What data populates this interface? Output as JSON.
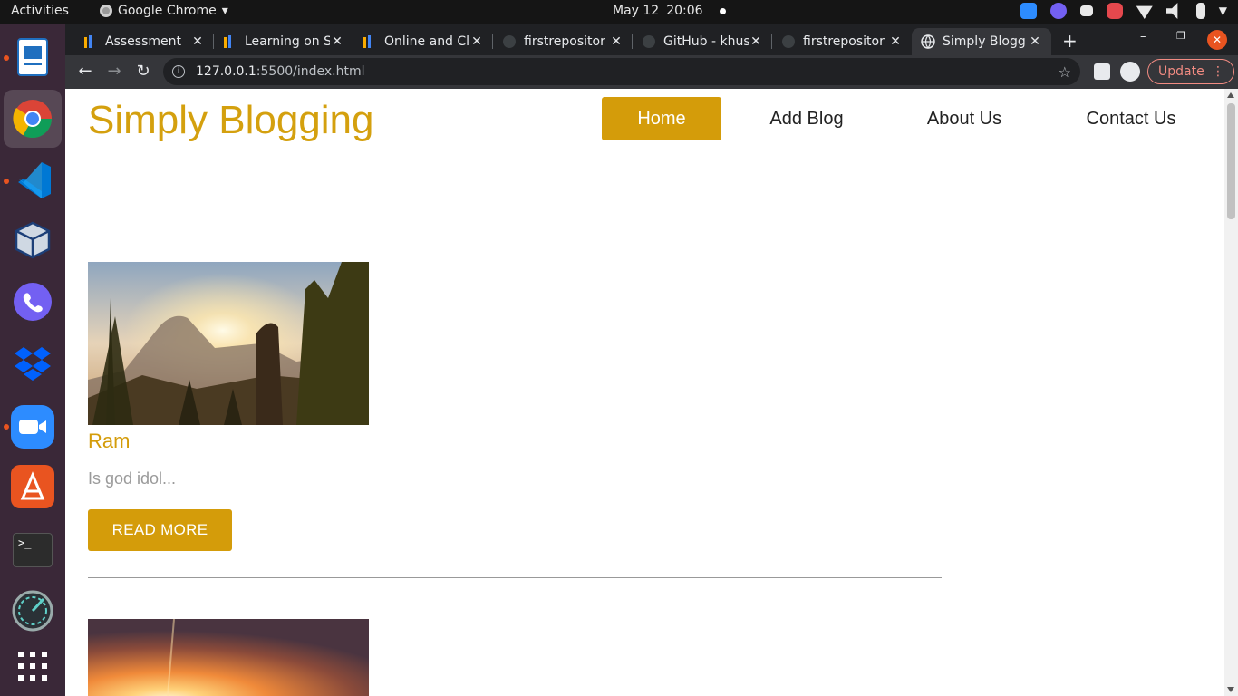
{
  "system": {
    "activities": "Activities",
    "app_name": "Google Chrome",
    "date": "May 12",
    "time": "20:06"
  },
  "browser": {
    "tabs": [
      {
        "label": "Assessment",
        "icon": "app-icon",
        "active": false
      },
      {
        "label": "Learning on S",
        "icon": "app-icon",
        "active": false
      },
      {
        "label": "Online and Cl",
        "icon": "app-icon",
        "active": false
      },
      {
        "label": "firstrepositor",
        "icon": "github-icon",
        "active": false
      },
      {
        "label": "GitHub - khus",
        "icon": "github-icon",
        "active": false
      },
      {
        "label": "firstrepositor",
        "icon": "github-icon",
        "active": false
      },
      {
        "label": "Simply Blogg",
        "icon": "globe-icon",
        "active": true
      }
    ],
    "url_host": "127.0.0.1",
    "url_rest": ":5500/index.html",
    "update_label": "Update"
  },
  "site": {
    "brand": "Simply Blogging",
    "accent": "#d49c0a",
    "nav": [
      {
        "label": "Home",
        "active": true
      },
      {
        "label": "Add Blog",
        "active": false
      },
      {
        "label": "About Us",
        "active": false
      },
      {
        "label": "Contact Us",
        "active": false
      }
    ],
    "posts": [
      {
        "title": "Ram",
        "excerpt": "Is god idol...",
        "button": "READ MORE"
      }
    ]
  }
}
